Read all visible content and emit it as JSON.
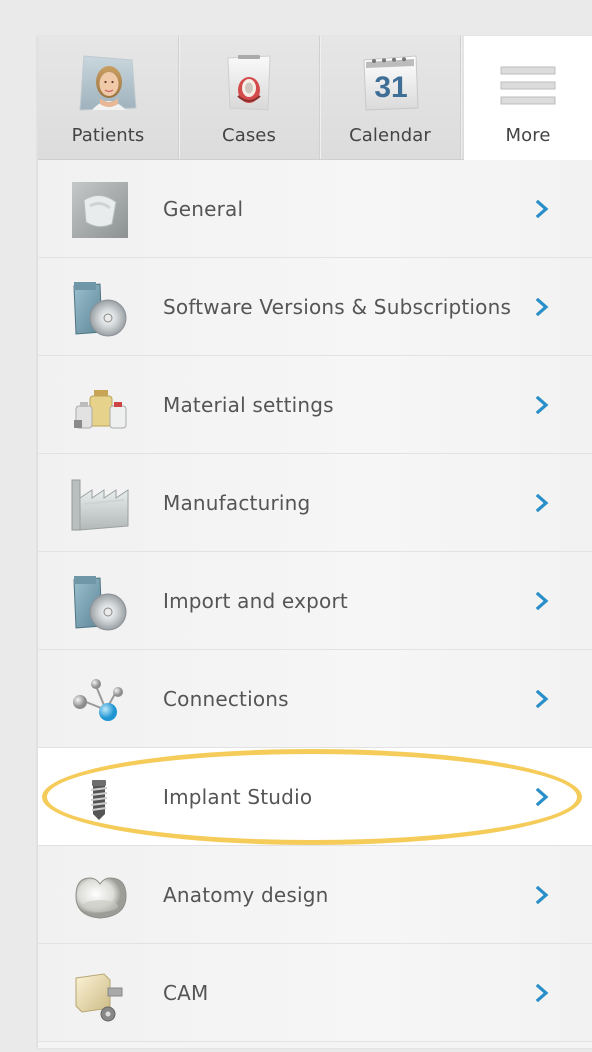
{
  "tabs": [
    {
      "label": "Patients",
      "icon": "patient-avatar-icon"
    },
    {
      "label": "Cases",
      "icon": "case-crown-icon"
    },
    {
      "label": "Calendar",
      "icon": "calendar-icon",
      "day": "31"
    },
    {
      "label": "More",
      "icon": "hamburger-menu-icon",
      "active": true
    }
  ],
  "menu": [
    {
      "label": "General",
      "icon": "general-settings-icon"
    },
    {
      "label": "Software Versions & Subscriptions",
      "icon": "software-disc-icon"
    },
    {
      "label": "Material settings",
      "icon": "material-bottles-icon"
    },
    {
      "label": "Manufacturing",
      "icon": "factory-icon"
    },
    {
      "label": "Import and export",
      "icon": "import-export-disc-icon"
    },
    {
      "label": "Connections",
      "icon": "connections-network-icon"
    },
    {
      "label": "Implant Studio",
      "icon": "implant-screw-icon",
      "highlighted": true
    },
    {
      "label": "Anatomy design",
      "icon": "tooth-crown-icon"
    },
    {
      "label": "CAM",
      "icon": "cam-block-icon"
    }
  ],
  "colors": {
    "accent": "#2a8fc9",
    "highlight_ring": "#f5cc5a",
    "text": "#555555"
  }
}
